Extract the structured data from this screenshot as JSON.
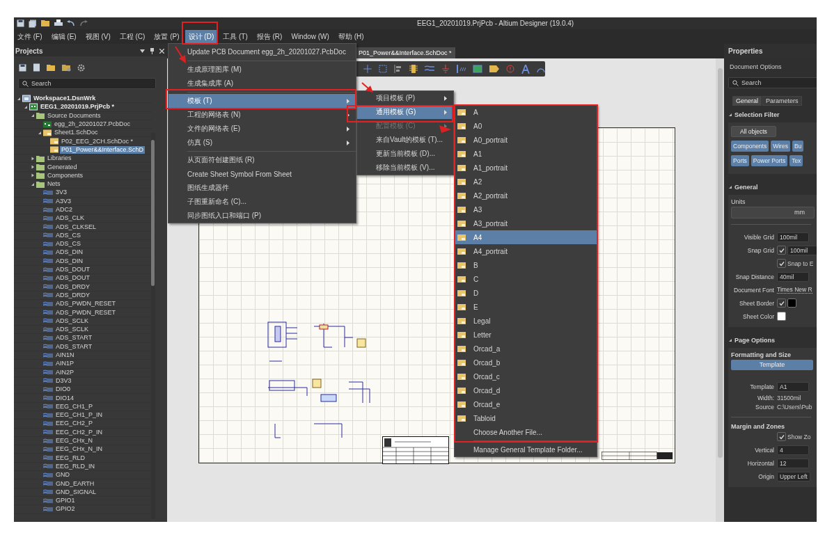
{
  "window": {
    "title": "EEG1_20201019.PrjPcb - Altium Designer (19.0.4)"
  },
  "menu_bar": [
    {
      "label": "文件 (F)",
      "selected": false
    },
    {
      "label": "编辑 (E)",
      "selected": false
    },
    {
      "label": "视图 (V)",
      "selected": false
    },
    {
      "label": "工程 (C)",
      "selected": false
    },
    {
      "label": "放置 (P)",
      "selected": false
    },
    {
      "label": "设计 (D)",
      "selected": true
    },
    {
      "label": "工具 (T)",
      "selected": false
    },
    {
      "label": "报告 (R)",
      "selected": false
    },
    {
      "label": "Window (W)",
      "selected": false
    },
    {
      "label": "帮助 (H)",
      "selected": false
    }
  ],
  "design_menu": [
    {
      "kind": "item",
      "label": "Update PCB Document egg_2h_20201027.PcbDoc",
      "submenu": false,
      "selected": false
    },
    {
      "kind": "separator"
    },
    {
      "kind": "item",
      "label": "生成原理图库 (M)",
      "submenu": false,
      "selected": false
    },
    {
      "kind": "item",
      "label": "生成集成库 (A)",
      "submenu": false,
      "selected": false
    },
    {
      "kind": "separator"
    },
    {
      "kind": "item",
      "label": "模板 (T)",
      "submenu": true,
      "selected": true
    },
    {
      "kind": "item",
      "label": "工程的网络表 (N)",
      "submenu": true,
      "selected": false
    },
    {
      "kind": "item",
      "label": "文件的网络表 (E)",
      "submenu": true,
      "selected": false
    },
    {
      "kind": "item",
      "label": "仿真 (S)",
      "submenu": true,
      "selected": false
    },
    {
      "kind": "separator"
    },
    {
      "kind": "item",
      "label": "从页面符创建图纸 (R)",
      "submenu": false,
      "selected": false
    },
    {
      "kind": "item",
      "label": "Create Sheet Symbol From Sheet",
      "submenu": false,
      "selected": false
    },
    {
      "kind": "item",
      "label": "图纸生成器件",
      "submenu": false,
      "selected": false
    },
    {
      "kind": "item",
      "label": "子图重新命名 (C)...",
      "submenu": false,
      "selected": false
    },
    {
      "kind": "item",
      "label": "同步图纸入口和端口 (P)",
      "submenu": false,
      "selected": false
    }
  ],
  "template_menu": [
    {
      "label": "项目模板 (P)",
      "submenu": true,
      "selected": false,
      "disabled": false
    },
    {
      "label": "通用模板 (G)",
      "submenu": true,
      "selected": true,
      "disabled": false
    },
    {
      "label": "配置模板 (C)",
      "submenu": true,
      "selected": false,
      "disabled": true
    },
    {
      "label": "来自Vault的模板 (T)...",
      "submenu": false,
      "selected": false,
      "disabled": false
    },
    {
      "label": "更新当前模板 (D)...",
      "submenu": false,
      "selected": false,
      "disabled": false
    },
    {
      "label": "移除当前模板 (V)...",
      "submenu": false,
      "selected": false,
      "disabled": false
    }
  ],
  "general_templates": [
    {
      "kind": "template",
      "label": "A",
      "selected": false
    },
    {
      "kind": "template",
      "label": "A0",
      "selected": false
    },
    {
      "kind": "template",
      "label": "A0_portrait",
      "selected": false
    },
    {
      "kind": "template",
      "label": "A1",
      "selected": false
    },
    {
      "kind": "template",
      "label": "A1_portrait",
      "selected": false
    },
    {
      "kind": "template",
      "label": "A2",
      "selected": false
    },
    {
      "kind": "template",
      "label": "A2_portrait",
      "selected": false
    },
    {
      "kind": "template",
      "label": "A3",
      "selected": false
    },
    {
      "kind": "template",
      "label": "A3_portrait",
      "selected": false
    },
    {
      "kind": "template",
      "label": "A4",
      "selected": true
    },
    {
      "kind": "template",
      "label": "A4_portrait",
      "selected": false
    },
    {
      "kind": "template",
      "label": "B",
      "selected": false
    },
    {
      "kind": "template",
      "label": "C",
      "selected": false
    },
    {
      "kind": "template",
      "label": "D",
      "selected": false
    },
    {
      "kind": "template",
      "label": "E",
      "selected": false
    },
    {
      "kind": "template",
      "label": "Legal",
      "selected": false
    },
    {
      "kind": "template",
      "label": "Letter",
      "selected": false
    },
    {
      "kind": "template",
      "label": "Orcad_a",
      "selected": false
    },
    {
      "kind": "template",
      "label": "Orcad_b",
      "selected": false
    },
    {
      "kind": "template",
      "label": "Orcad_c",
      "selected": false
    },
    {
      "kind": "template",
      "label": "Orcad_d",
      "selected": false
    },
    {
      "kind": "template",
      "label": "Orcad_e",
      "selected": false
    },
    {
      "kind": "template",
      "label": "Tabloid",
      "selected": false
    },
    {
      "kind": "action",
      "label": "Choose Another File..."
    },
    {
      "kind": "separator"
    },
    {
      "kind": "action",
      "label": "Manage General Template Folder..."
    }
  ],
  "projects": {
    "title": "Projects",
    "search": {
      "placeholder": "Search"
    },
    "tree": [
      {
        "kind": "workspace",
        "label": "Workspace1.DsnWrk",
        "selected": false,
        "expanded": true,
        "children": [
          {
            "kind": "project",
            "label": "EEG1_20201019.PrjPcb *",
            "selected": false,
            "expanded": true,
            "children": [
              {
                "kind": "folder",
                "label": "Source Documents",
                "selected": false,
                "expanded": true,
                "children": [
                  {
                    "kind": "pcb",
                    "label": "egg_2h_20201027.PcbDoc",
                    "selected": false
                  },
                  {
                    "kind": "sch",
                    "label": "Sheet1.SchDoc",
                    "selected": false,
                    "expanded": true,
                    "children": [
                      {
                        "kind": "sch",
                        "label": "P02_EEG_2CH.SchDoc *",
                        "selected": false
                      },
                      {
                        "kind": "sch",
                        "label": "P01_Power&&Interface.SchD",
                        "selected": true
                      }
                    ]
                  }
                ]
              },
              {
                "kind": "folder",
                "label": "Libraries",
                "selected": false,
                "expanded": false
              },
              {
                "kind": "folder",
                "label": "Generated",
                "selected": false,
                "expanded": false
              },
              {
                "kind": "folder",
                "label": "Components",
                "selected": false,
                "expanded": false
              },
              {
                "kind": "folder",
                "label": "Nets",
                "selected": false,
                "expanded": true,
                "children": [
                  {
                    "kind": "net",
                    "label": "3V3",
                    "selected": false
                  },
                  {
                    "kind": "net",
                    "label": "A3V3",
                    "selected": false
                  },
                  {
                    "kind": "net",
                    "label": "ADC2",
                    "selected": false
                  },
                  {
                    "kind": "net",
                    "label": "ADS_CLK",
                    "selected": false
                  },
                  {
                    "kind": "net",
                    "label": "ADS_CLKSEL",
                    "selected": false
                  },
                  {
                    "kind": "net",
                    "label": "ADS_CS",
                    "selected": false
                  },
                  {
                    "kind": "net",
                    "label": "ADS_CS",
                    "selected": false
                  },
                  {
                    "kind": "net",
                    "label": "ADS_DIN",
                    "selected": false
                  },
                  {
                    "kind": "net",
                    "label": "ADS_DIN",
                    "selected": false
                  },
                  {
                    "kind": "net",
                    "label": "ADS_DOUT",
                    "selected": false
                  },
                  {
                    "kind": "net",
                    "label": "ADS_DOUT",
                    "selected": false
                  },
                  {
                    "kind": "net",
                    "label": "ADS_DRDY",
                    "selected": false
                  },
                  {
                    "kind": "net",
                    "label": "ADS_DRDY",
                    "selected": false
                  },
                  {
                    "kind": "net",
                    "label": "ADS_PWDN_RESET",
                    "selected": false
                  },
                  {
                    "kind": "net",
                    "label": "ADS_PWDN_RESET",
                    "selected": false
                  },
                  {
                    "kind": "net",
                    "label": "ADS_SCLK",
                    "selected": false
                  },
                  {
                    "kind": "net",
                    "label": "ADS_SCLK",
                    "selected": false
                  },
                  {
                    "kind": "net",
                    "label": "ADS_START",
                    "selected": false
                  },
                  {
                    "kind": "net",
                    "label": "ADS_START",
                    "selected": false
                  },
                  {
                    "kind": "net",
                    "label": "AIN1N",
                    "selected": false
                  },
                  {
                    "kind": "net",
                    "label": "AIN1P",
                    "selected": false
                  },
                  {
                    "kind": "net",
                    "label": "AIN2P",
                    "selected": false
                  },
                  {
                    "kind": "net",
                    "label": "D3V3",
                    "selected": false
                  },
                  {
                    "kind": "net",
                    "label": "DIO0",
                    "selected": false
                  },
                  {
                    "kind": "net",
                    "label": "DIO14",
                    "selected": false
                  },
                  {
                    "kind": "net",
                    "label": "EEG_CH1_P",
                    "selected": false
                  },
                  {
                    "kind": "net",
                    "label": "EEG_CH1_P_IN",
                    "selected": false
                  },
                  {
                    "kind": "net",
                    "label": "EEG_CH2_P",
                    "selected": false
                  },
                  {
                    "kind": "net",
                    "label": "EEG_CH2_P_IN",
                    "selected": false
                  },
                  {
                    "kind": "net",
                    "label": "EEG_CHx_N",
                    "selected": false
                  },
                  {
                    "kind": "net",
                    "label": "EEG_CHx_N_IN",
                    "selected": false
                  },
                  {
                    "kind": "net",
                    "label": "EEG_RLD",
                    "selected": false
                  },
                  {
                    "kind": "net",
                    "label": "EEG_RLD_IN",
                    "selected": false
                  },
                  {
                    "kind": "net",
                    "label": "GND",
                    "selected": false
                  },
                  {
                    "kind": "net",
                    "label": "GND_EARTH",
                    "selected": false
                  },
                  {
                    "kind": "net",
                    "label": "GND_SIGNAL",
                    "selected": false
                  },
                  {
                    "kind": "net",
                    "label": "GPIO1",
                    "selected": false
                  },
                  {
                    "kind": "net",
                    "label": "GPIO2",
                    "selected": false
                  }
                ]
              }
            ]
          }
        ]
      }
    ]
  },
  "document_tabs": [
    {
      "label": "P01_Power&&Interface.SchDoc *",
      "selected": true
    }
  ],
  "properties": {
    "title": "Properties",
    "subtitle": "Document Options",
    "search": {
      "placeholder": "Search"
    },
    "tabs": [
      {
        "label": "General",
        "selected": true
      },
      {
        "label": "Parameters",
        "selected": false
      }
    ],
    "selection_filter": {
      "title": "Selection Filter",
      "expanded": true,
      "rows": [
        [
          {
            "label": "All objects",
            "selected": false
          }
        ],
        [
          {
            "label": "Components",
            "selected": true
          },
          {
            "label": "Wires",
            "selected": true
          },
          {
            "label": "Bu",
            "selected": true
          }
        ],
        [
          {
            "label": "Ports",
            "selected": true
          },
          {
            "label": "Power Ports",
            "selected": true
          },
          {
            "label": "Tex",
            "selected": true
          }
        ]
      ]
    },
    "general": {
      "title": "General",
      "expanded": true,
      "units": {
        "label": "Units",
        "value": "mm"
      },
      "fields": [
        {
          "kind": "input",
          "label": "Visible Grid",
          "value": "100mil"
        },
        {
          "kind": "check_input",
          "label": "Snap Grid",
          "checked": true,
          "value": "100mil"
        },
        {
          "kind": "check",
          "label": "Snap to E",
          "checked": true
        },
        {
          "kind": "input",
          "label": "Snap Distance",
          "value": "40mil"
        },
        {
          "kind": "link",
          "label": "Document Font",
          "value": "Times New R"
        },
        {
          "kind": "check_color",
          "label": "Sheet Border",
          "checked": true,
          "color": "#000000"
        },
        {
          "kind": "color",
          "label": "Sheet Color",
          "color": "#ffffff"
        }
      ]
    },
    "page_options": {
      "title": "Page Options",
      "expanded": true,
      "formatting_title": "Formatting and Size",
      "mode_button": "Template",
      "fields": [
        {
          "kind": "input",
          "label": "Template",
          "value": "A1"
        },
        {
          "kind": "text",
          "label": "Width:",
          "value": "31500mil"
        },
        {
          "kind": "text",
          "label": "Source",
          "value": "C:\\Users\\Pub"
        }
      ],
      "margin_title": "Margin and Zones",
      "margin_fields": [
        {
          "kind": "check",
          "label": "Show Zo",
          "checked": true
        },
        {
          "kind": "input",
          "label": "Vertical",
          "value": "4"
        },
        {
          "kind": "input",
          "label": "Horizontal",
          "value": "12"
        },
        {
          "kind": "input",
          "label": "Origin",
          "value": "Upper Left"
        }
      ]
    }
  }
}
